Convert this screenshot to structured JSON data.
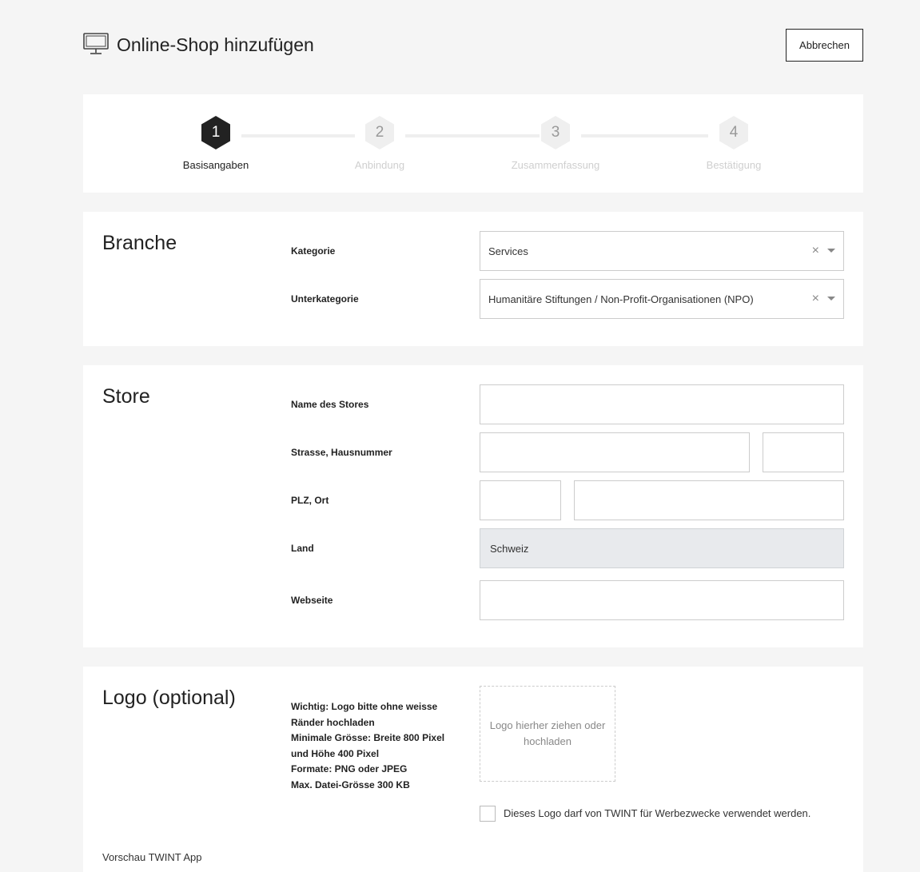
{
  "header": {
    "title": "Online-Shop hinzufügen",
    "icon": "monitor-icon",
    "cancel_label": "Abbrechen"
  },
  "stepper": {
    "steps": [
      {
        "number": "1",
        "label": "Basisangaben",
        "active": true
      },
      {
        "number": "2",
        "label": "Anbindung",
        "active": false
      },
      {
        "number": "3",
        "label": "Zusammenfassung",
        "active": false
      },
      {
        "number": "4",
        "label": "Bestätigung",
        "active": false
      }
    ]
  },
  "branche": {
    "title": "Branche",
    "kategorie_label": "Kategorie",
    "kategorie_value": "Services",
    "unterkategorie_label": "Unterkategorie",
    "unterkategorie_value": "Humanitäre Stiftungen / Non-Profit-Organisationen (NPO)",
    "clear_glyph": "×"
  },
  "store": {
    "title": "Store",
    "name_label": "Name des Stores",
    "name_value": "",
    "strasse_label": "Strasse, Hausnummer",
    "strasse_value": "",
    "hausnummer_value": "",
    "plz_label": "PLZ, Ort",
    "plz_value": "",
    "ort_value": "",
    "land_label": "Land",
    "land_value": "Schweiz",
    "webseite_label": "Webseite",
    "webseite_value": ""
  },
  "logo": {
    "title": "Logo (optional)",
    "hint_lines": [
      "Wichtig: Logo bitte ohne weisse Ränder hochladen",
      "Minimale Grösse: Breite 800 Pixel und Höhe 400 Pixel",
      "Formate: PNG oder JPEG",
      "Max. Datei-Grösse 300 KB"
    ],
    "dropzone_text": "Logo hierher ziehen oder hochladen",
    "checkbox_label": "Dieses Logo darf von TWINT für Werbezwecke verwendet werden.",
    "checkbox_checked": false,
    "preview_label": "Vorschau TWINT App"
  },
  "colors": {
    "active_step": "#222222",
    "inactive_step": "#efefef",
    "disabled_field": "#e8eaed"
  }
}
